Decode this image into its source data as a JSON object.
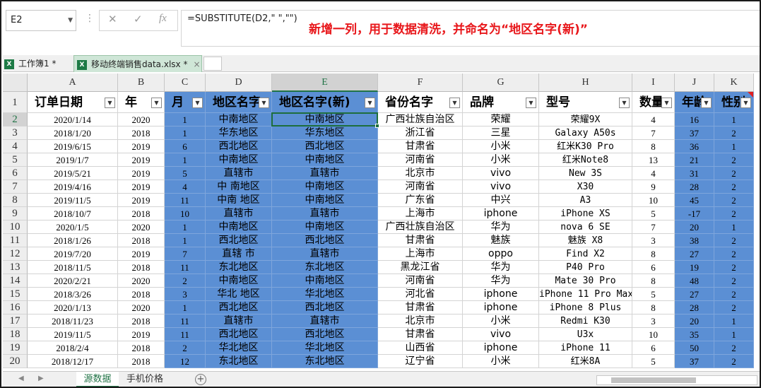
{
  "name_box": "E2",
  "formula": "=SUBSTITUTE(D2,\" \",\"\")",
  "annotation": "新增一列，用于数据清洗，并命名为“地区名字(新)”",
  "workbook_tabs": [
    {
      "label": "工作簿1 *"
    },
    {
      "label": "移动终端销售data.xlsx *",
      "close": "×"
    }
  ],
  "columns": [
    "A",
    "B",
    "C",
    "D",
    "E",
    "F",
    "G",
    "H",
    "I",
    "J",
    "K"
  ],
  "headers": [
    "订单日期",
    "年",
    "月",
    "地区名字",
    "地区名字(新)",
    "省份名字",
    "品牌",
    "型号",
    "数量",
    "年龄",
    "性别"
  ],
  "rows": [
    {
      "n": "2",
      "cells": [
        "2020/1/14",
        "2020",
        "1",
        "中南地区",
        "中南地区",
        "广西壮族自治区",
        "荣耀",
        "荣耀9X",
        "4",
        "16",
        "1"
      ]
    },
    {
      "n": "3",
      "cells": [
        "2018/1/20",
        "2018",
        "1",
        "华东地区",
        "华东地区",
        "浙江省",
        "三星",
        "Galaxy A50s",
        "7",
        "37",
        "2"
      ]
    },
    {
      "n": "4",
      "cells": [
        "2019/6/15",
        "2019",
        "6",
        "西北地区",
        "西北地区",
        "甘肃省",
        "小米",
        "红米K30 Pro",
        "8",
        "36",
        "1"
      ]
    },
    {
      "n": "5",
      "cells": [
        "2019/1/7",
        "2019",
        "1",
        "中南地区",
        "中南地区",
        "河南省",
        "小米",
        "红米Note8",
        "13",
        "21",
        "2"
      ]
    },
    {
      "n": "6",
      "cells": [
        "2019/5/21",
        "2019",
        "5",
        "直辖市",
        "直辖市",
        "北京市",
        "vivo",
        "New 3S",
        "4",
        "31",
        "2"
      ]
    },
    {
      "n": "7",
      "cells": [
        "2019/4/16",
        "2019",
        "4",
        "中 南地区",
        "中南地区",
        "河南省",
        "vivo",
        "X30",
        "9",
        "28",
        "2"
      ]
    },
    {
      "n": "8",
      "cells": [
        "2019/11/5",
        "2019",
        "11",
        "中南 地区",
        "中南地区",
        "广东省",
        "中兴",
        "A3",
        "10",
        "45",
        "2"
      ]
    },
    {
      "n": "9",
      "cells": [
        "2018/10/7",
        "2018",
        "10",
        "直辖市",
        "直辖市",
        "上海市",
        "iphone",
        "iPhone XS",
        "5",
        "-17",
        "2"
      ]
    },
    {
      "n": "10",
      "cells": [
        "2020/1/5",
        "2020",
        "1",
        "中南地区",
        "中南地区",
        "广西壮族自治区",
        "华为",
        "nova 6 SE",
        "7",
        "20",
        "1"
      ]
    },
    {
      "n": "11",
      "cells": [
        "2018/1/26",
        "2018",
        "1",
        "西北地区",
        "西北地区",
        "甘肃省",
        "魅族",
        "魅族 X8",
        "3",
        "38",
        "2"
      ]
    },
    {
      "n": "12",
      "cells": [
        "2019/7/20",
        "2019",
        "7",
        "直辖  市",
        "直辖市",
        "上海市",
        "oppo",
        "Find X2",
        "8",
        "27",
        "2"
      ]
    },
    {
      "n": "13",
      "cells": [
        "2018/11/5",
        "2018",
        "11",
        "东北地区",
        "东北地区",
        "黑龙江省",
        "华为",
        "P40 Pro",
        "6",
        "19",
        "2"
      ]
    },
    {
      "n": "14",
      "cells": [
        "2020/2/21",
        "2020",
        "2",
        "中南地区",
        "中南地区",
        "河南省",
        "华为",
        "Mate 30 Pro",
        "8",
        "48",
        "2"
      ]
    },
    {
      "n": "15",
      "cells": [
        "2018/3/26",
        "2018",
        "3",
        "华北   地区",
        "华北地区",
        "河北省",
        "iphone",
        "iPhone 11 Pro Max",
        "5",
        "27",
        "2"
      ]
    },
    {
      "n": "16",
      "cells": [
        "2020/1/13",
        "2020",
        "1",
        "西北地区",
        "西北地区",
        "甘肃省",
        "iphone",
        "iPhone 8 Plus",
        "8",
        "28",
        "2"
      ]
    },
    {
      "n": "17",
      "cells": [
        "2018/11/23",
        "2018",
        "11",
        "直辖市",
        "直辖市",
        "北京市",
        "小米",
        "Redmi K30",
        "3",
        "20",
        "1"
      ]
    },
    {
      "n": "18",
      "cells": [
        "2019/11/5",
        "2019",
        "11",
        "西北地区",
        "西北地区",
        "甘肃省",
        "vivo",
        "U3x",
        "10",
        "35",
        "1"
      ]
    },
    {
      "n": "19",
      "cells": [
        "2018/2/4",
        "2018",
        "2",
        "华北地区",
        "华北地区",
        "山西省",
        "iphone",
        "iPhone 11",
        "6",
        "50",
        "2"
      ]
    },
    {
      "n": "20",
      "cells": [
        "2018/12/17",
        "2018",
        "12",
        "东北地区",
        "东北地区",
        "辽宁省",
        "小米",
        "红米8A",
        "5",
        "37",
        "2"
      ]
    }
  ],
  "sheet_tabs": [
    "源数据",
    "手机价格"
  ],
  "add_sheet": "+",
  "colors": {
    "blue_fill": "#5b8fd4",
    "annotation": "#e8171b",
    "accent": "#217346"
  }
}
